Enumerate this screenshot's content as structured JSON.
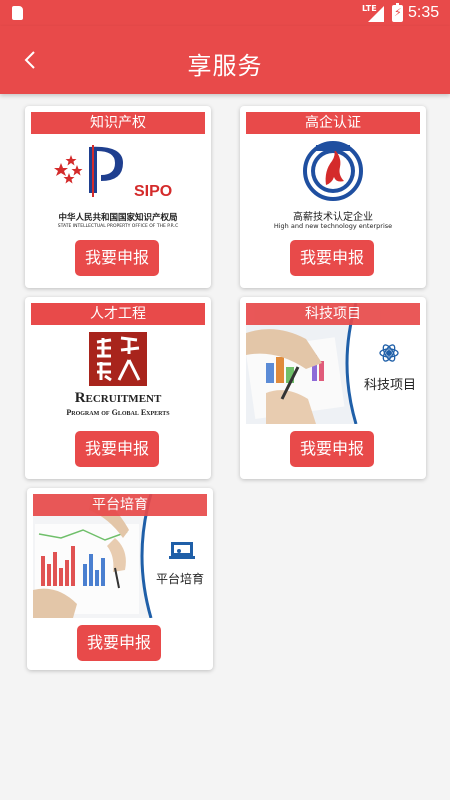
{
  "status_bar": {
    "network": "LTE",
    "time": "5:35"
  },
  "header": {
    "title": "享服务"
  },
  "services": [
    {
      "title": "知识产权",
      "image": {
        "logo_text": "SIPO",
        "caption_cn": "中华人民共和国国家知识产权局",
        "caption_en": "STATE INTELLECTUAL PROPERTY OFFICE OF THE P.R.C"
      },
      "button": "我要申报"
    },
    {
      "title": "高企认证",
      "image": {
        "caption_cn": "高薪技术认定企业",
        "caption_en": "High and new technology enterprise"
      },
      "button": "我要申报"
    },
    {
      "title": "人才工程",
      "image": {
        "caption_big": "Recruitment",
        "caption_small": "Program of Global Experts"
      },
      "button": "我要申报"
    },
    {
      "title": "科技项目",
      "image": {
        "caption": "科技项目"
      },
      "button": "我要申报"
    },
    {
      "title": "平台培育",
      "image": {
        "caption": "平台培育"
      },
      "button": "我要申报"
    }
  ],
  "colors": {
    "primary": "#e84a4a",
    "background": "#f4f4f4"
  }
}
